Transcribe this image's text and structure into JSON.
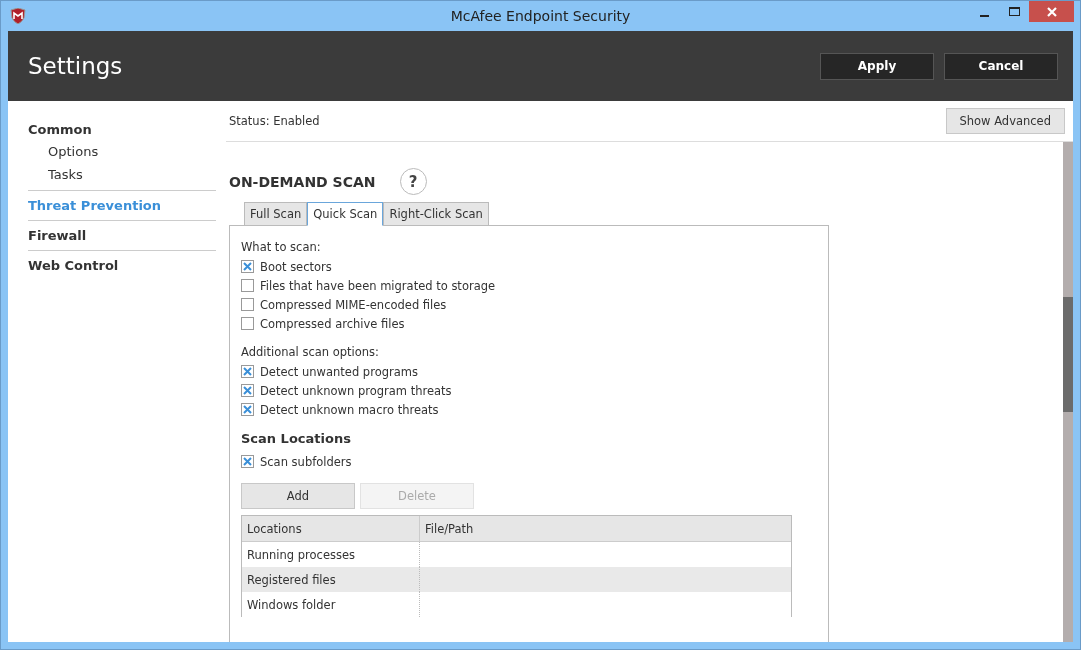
{
  "window": {
    "title": "McAfee Endpoint Security"
  },
  "header": {
    "title": "Settings",
    "buttons": [
      "Apply",
      "Cancel"
    ]
  },
  "sidebar": {
    "items": [
      {
        "label": "Common",
        "selected": false,
        "children": [
          {
            "label": "Options",
            "selected": false
          },
          {
            "label": "Tasks",
            "selected": false
          }
        ]
      },
      {
        "label": "Threat Prevention",
        "selected": true
      },
      {
        "label": "Firewall",
        "selected": false
      },
      {
        "label": "Web Control",
        "selected": false
      }
    ]
  },
  "status": {
    "text": "Status: Enabled",
    "button": "Show Advanced"
  },
  "section": {
    "title": "ON-DEMAND SCAN",
    "help": "?"
  },
  "tabs": [
    {
      "label": "Full Scan",
      "selected": false
    },
    {
      "label": "Quick Scan",
      "selected": true
    },
    {
      "label": "Right-Click Scan",
      "selected": false
    }
  ],
  "groups": [
    {
      "title": "What to scan:",
      "kind": "label",
      "options": [
        {
          "label": "Boot sectors",
          "checked": true
        },
        {
          "label": "Files that have been migrated to storage",
          "checked": false
        },
        {
          "label": "Compressed MIME-encoded files",
          "checked": false
        },
        {
          "label": "Compressed archive files",
          "checked": false
        }
      ]
    },
    {
      "title": "Additional scan options:",
      "kind": "label",
      "options": [
        {
          "label": "Detect unwanted programs",
          "checked": true
        },
        {
          "label": "Detect unknown program threats",
          "checked": true
        },
        {
          "label": "Detect unknown macro threats",
          "checked": true
        }
      ]
    },
    {
      "title": "Scan Locations",
      "kind": "heading",
      "options": [
        {
          "label": "Scan subfolders",
          "checked": true
        }
      ]
    }
  ],
  "location_buttons": [
    {
      "label": "Add",
      "disabled": false
    },
    {
      "label": "Delete",
      "disabled": true
    }
  ],
  "table": {
    "columns": [
      "Locations",
      "File/Path"
    ],
    "rows": [
      {
        "cells": [
          "Running processes",
          ""
        ],
        "selected": false
      },
      {
        "cells": [
          "Registered files",
          ""
        ],
        "selected": true
      },
      {
        "cells": [
          "Windows folder",
          ""
        ],
        "selected": false
      }
    ]
  }
}
